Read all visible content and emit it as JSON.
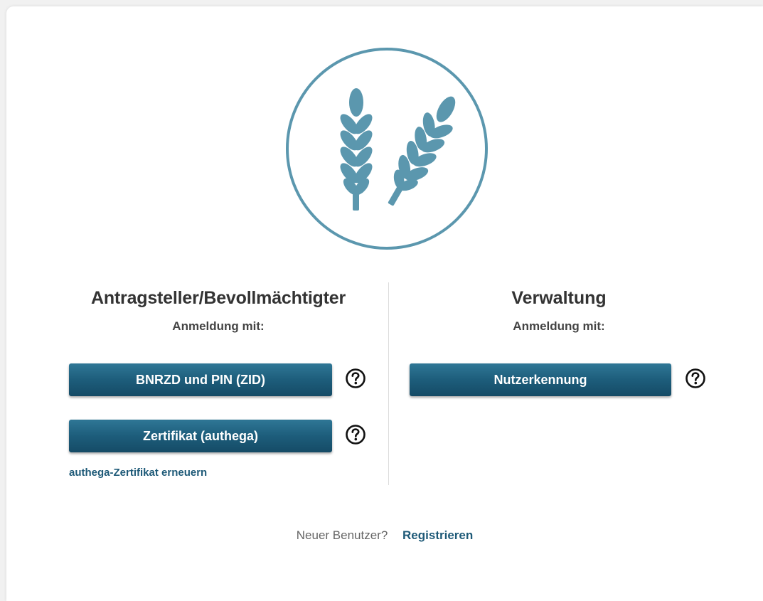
{
  "applicant": {
    "title": "Antragsteller/Bevollmächtigter",
    "subtitle": "Anmeldung mit:",
    "btn_bnrzd": "BNRZD und PIN (ZID)",
    "btn_cert": "Zertifikat (authega)",
    "renew_link": "authega-Zertifikat erneuern"
  },
  "admin": {
    "title": "Verwaltung",
    "subtitle": "Anmeldung mit:",
    "btn_user": "Nutzerkennung"
  },
  "footer": {
    "question": "Neuer Benutzer?",
    "register": "Registrieren"
  },
  "icons": {
    "logo": "wheat-ears-icon",
    "help": "question-circle-icon"
  },
  "colors": {
    "accent": "#5b97ae",
    "button": "#1d5d7b",
    "link": "#1e5a78"
  }
}
